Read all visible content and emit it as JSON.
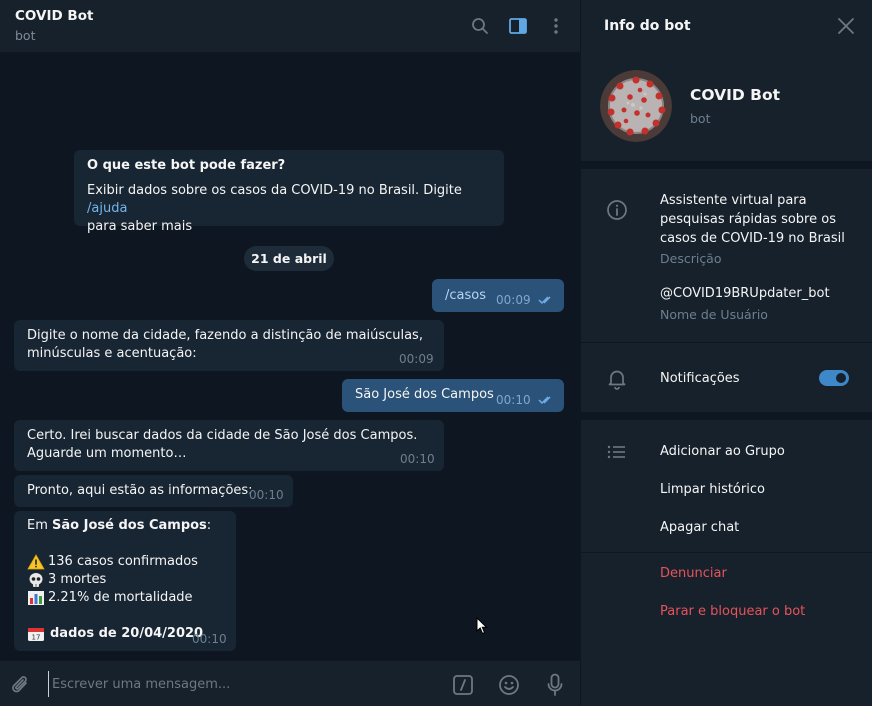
{
  "header": {
    "title": "COVID Bot",
    "subtitle": "bot"
  },
  "intro": {
    "title": "O que este bot pode fazer?",
    "text_before": "Exibir dados sobre os casos da COVID-19 no Brasil. Digite ",
    "link": "/ajuda",
    "text_after": "para saber mais"
  },
  "date_separator": "21 de abril",
  "messages": [
    {
      "dir": "out",
      "text": "/casos",
      "time": "00:09"
    },
    {
      "dir": "in",
      "line1": "Digite o nome da cidade, fazendo a distinção de maiúsculas,",
      "line2": "minúsculas e acentuação:",
      "time": "00:09"
    },
    {
      "dir": "out",
      "text": "São José dos Campos",
      "time": "00:10"
    },
    {
      "dir": "in",
      "line1": "Certo. Irei buscar dados da cidade de São José dos Campos.",
      "line2": "Aguarde um momento…",
      "time": "00:10"
    },
    {
      "dir": "in",
      "text": "Pronto, aqui estão as informações:",
      "time": "00:10"
    },
    {
      "dir": "in",
      "prefix": "Em ",
      "city": "São José dos Campos",
      "suffix": ":",
      "confirmed": "136 casos confirmados",
      "deaths": "3 mortes",
      "mortality": "2.21% de mortalidade",
      "date_line": "dados de 20/04/2020",
      "time": "00:10"
    }
  ],
  "composer": {
    "placeholder": "Escrever uma mensagem..."
  },
  "info_panel": {
    "title": "Info do bot",
    "bot_name": "COVID Bot",
    "bot_sub": "bot",
    "description_line1": "Assistente virtual para",
    "description_line2": "pesquisas rápidas sobre os",
    "description_line3": "casos de COVID-19 no Brasil",
    "description_label": "Descrição",
    "username": "@COVID19BRUpdater_bot",
    "username_label": "Nome de Usuário",
    "notifications_label": "Notificações",
    "notifications_on": true,
    "actions": [
      "Adicionar ao Grupo",
      "Limpar histórico",
      "Apagar chat"
    ],
    "danger_actions": [
      "Denunciar",
      "Parar e bloquear o bot"
    ]
  },
  "colors": {
    "background": "#0e1621",
    "panel": "#17212b",
    "bubble_in": "#182533",
    "bubble_out": "#2b5278",
    "accent": "#3e88c9",
    "danger": "#e5535b"
  },
  "icons": [
    "search-icon",
    "sidebar-toggle-icon",
    "more-vertical-icon",
    "attach-icon",
    "commands-icon",
    "emoji-icon",
    "microphone-icon",
    "close-icon",
    "info-icon",
    "bell-icon",
    "list-icon",
    "warning-emoji",
    "skull-emoji",
    "chart-emoji",
    "calendar-emoji",
    "read-ticks-icon"
  ]
}
